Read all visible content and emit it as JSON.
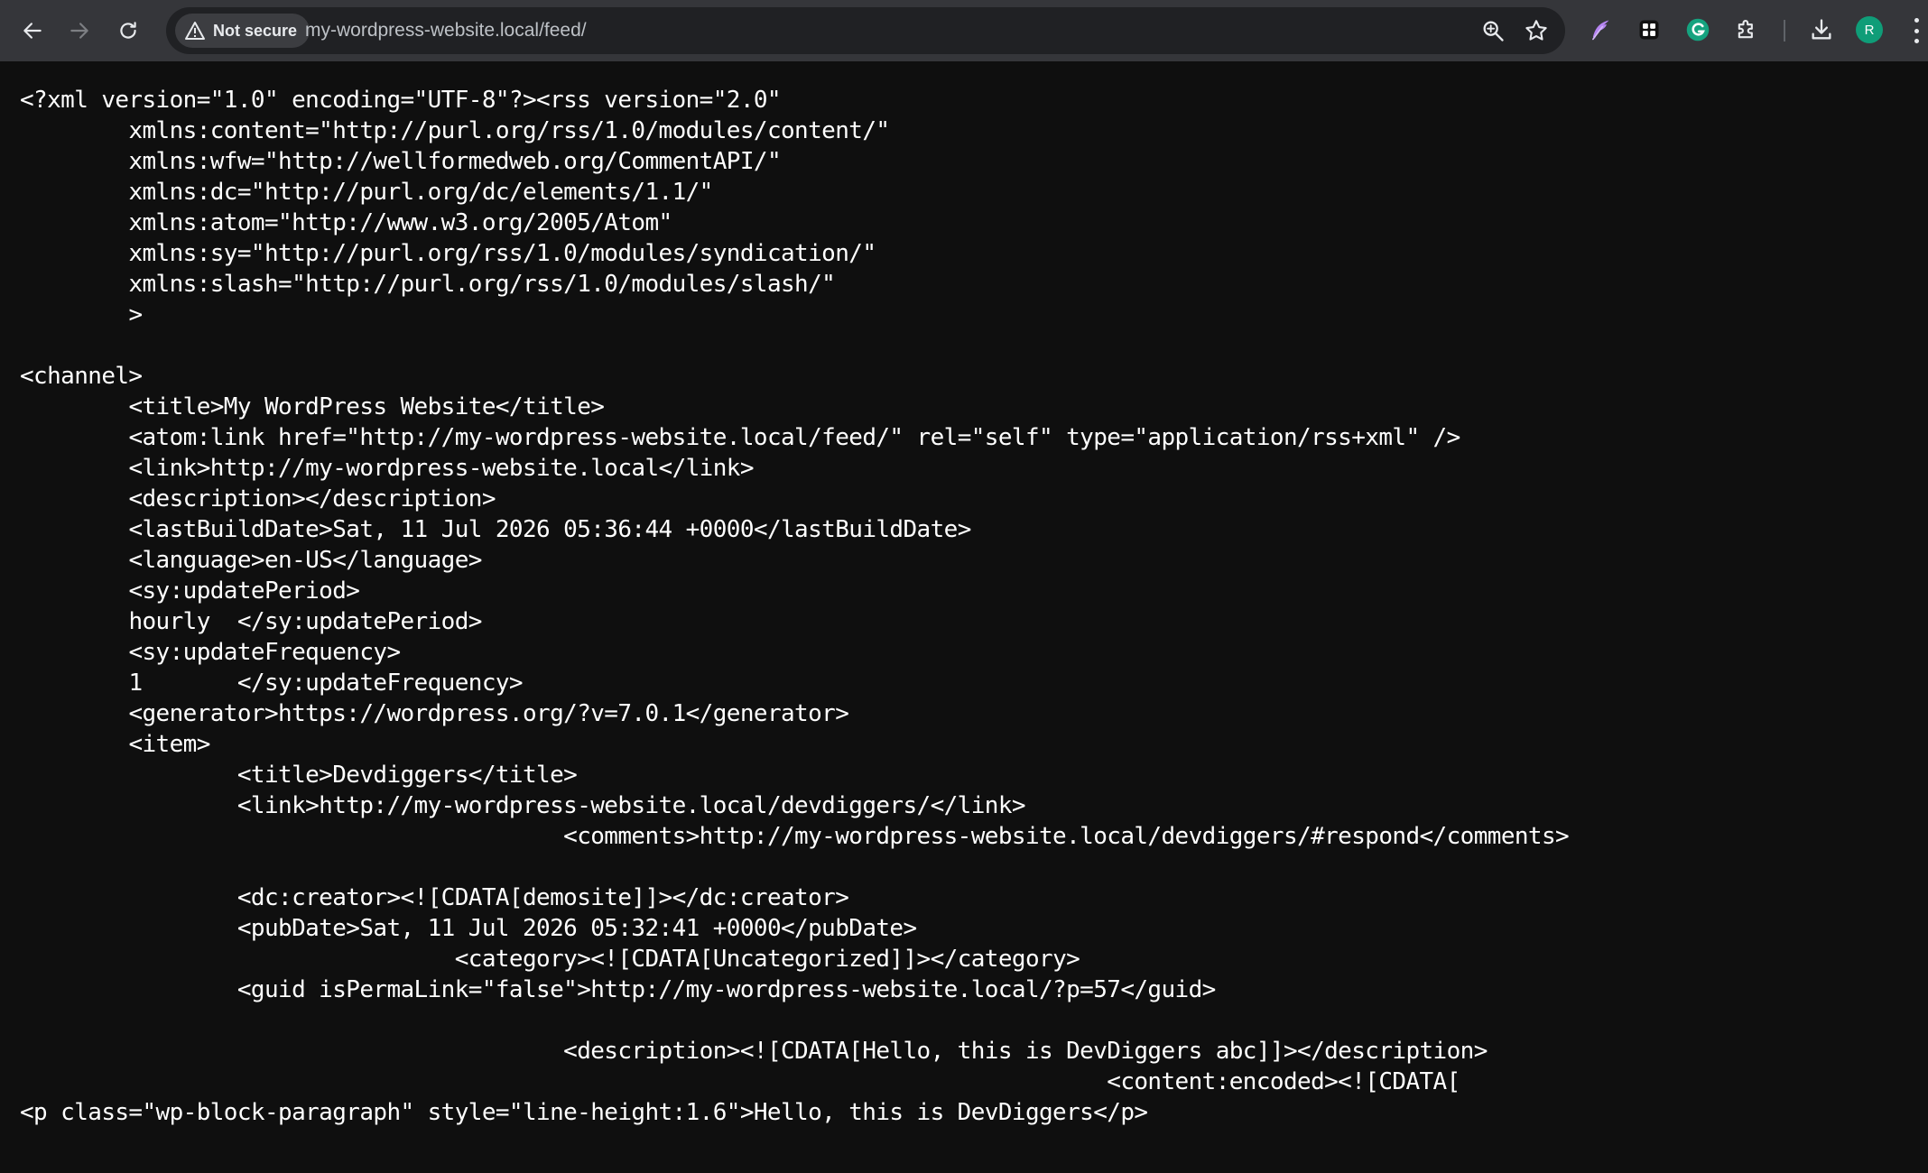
{
  "browser": {
    "security_label": "Not secure",
    "url": "my-wordpress-website.local/feed/",
    "avatar_letter": "R",
    "colors": {
      "toolbar_bg": "#35363a",
      "omnibox_bg": "#202124",
      "page_bg": "#0f0f0f",
      "text": "#ffffff",
      "avatar_bg": "#0f9d78"
    }
  },
  "icons": {
    "back": "arrow-left",
    "forward": "arrow-right",
    "reload": "circular-arrow",
    "warning": "warning-triangle",
    "zoom": "magnifier",
    "bookmark": "star",
    "ext1": "feather-pen",
    "ext2": "four-squares",
    "ext3": "grammarly-g",
    "ext4": "puzzle-piece",
    "download": "download-arrow",
    "menu": "three-vertical-dots"
  },
  "source_lines": [
    "<?xml version=\"1.0\" encoding=\"UTF-8\"?><rss version=\"2.0\"",
    "\txmlns:content=\"http://purl.org/rss/1.0/modules/content/\"",
    "\txmlns:wfw=\"http://wellformedweb.org/CommentAPI/\"",
    "\txmlns:dc=\"http://purl.org/dc/elements/1.1/\"",
    "\txmlns:atom=\"http://www.w3.org/2005/Atom\"",
    "\txmlns:sy=\"http://purl.org/rss/1.0/modules/syndication/\"",
    "\txmlns:slash=\"http://purl.org/rss/1.0/modules/slash/\"",
    "\t>",
    "",
    "<channel>",
    "\t<title>My WordPress Website</title>",
    "\t<atom:link href=\"http://my-wordpress-website.local/feed/\" rel=\"self\" type=\"application/rss+xml\" />",
    "\t<link>http://my-wordpress-website.local</link>",
    "\t<description></description>",
    "\t<lastBuildDate>Sat, 11 Jul 2026 05:36:44 +0000</lastBuildDate>",
    "\t<language>en-US</language>",
    "\t<sy:updatePeriod>",
    "\thourly\t</sy:updatePeriod>",
    "\t<sy:updateFrequency>",
    "\t1\t</sy:updateFrequency>",
    "\t<generator>https://wordpress.org/?v=7.0.1</generator>",
    "\t<item>",
    "\t\t<title>Devdiggers</title>",
    "\t\t<link>http://my-wordpress-website.local/devdiggers/</link>",
    "\t\t\t\t\t<comments>http://my-wordpress-website.local/devdiggers/#respond</comments>",
    "",
    "\t\t<dc:creator><![CDATA[demosite]]></dc:creator>",
    "\t\t<pubDate>Sat, 11 Jul 2026 05:32:41 +0000</pubDate>",
    "\t\t\t\t<category><![CDATA[Uncategorized]]></category>",
    "\t\t<guid isPermaLink=\"false\">http://my-wordpress-website.local/?p=57</guid>",
    "",
    "\t\t\t\t\t<description><![CDATA[Hello, this is DevDiggers abc]]></description>",
    "\t\t\t\t\t\t\t\t\t\t<content:encoded><![CDATA[",
    "<p class=\"wp-block-paragraph\" style=\"line-height:1.6\">Hello, this is DevDiggers</p>"
  ]
}
